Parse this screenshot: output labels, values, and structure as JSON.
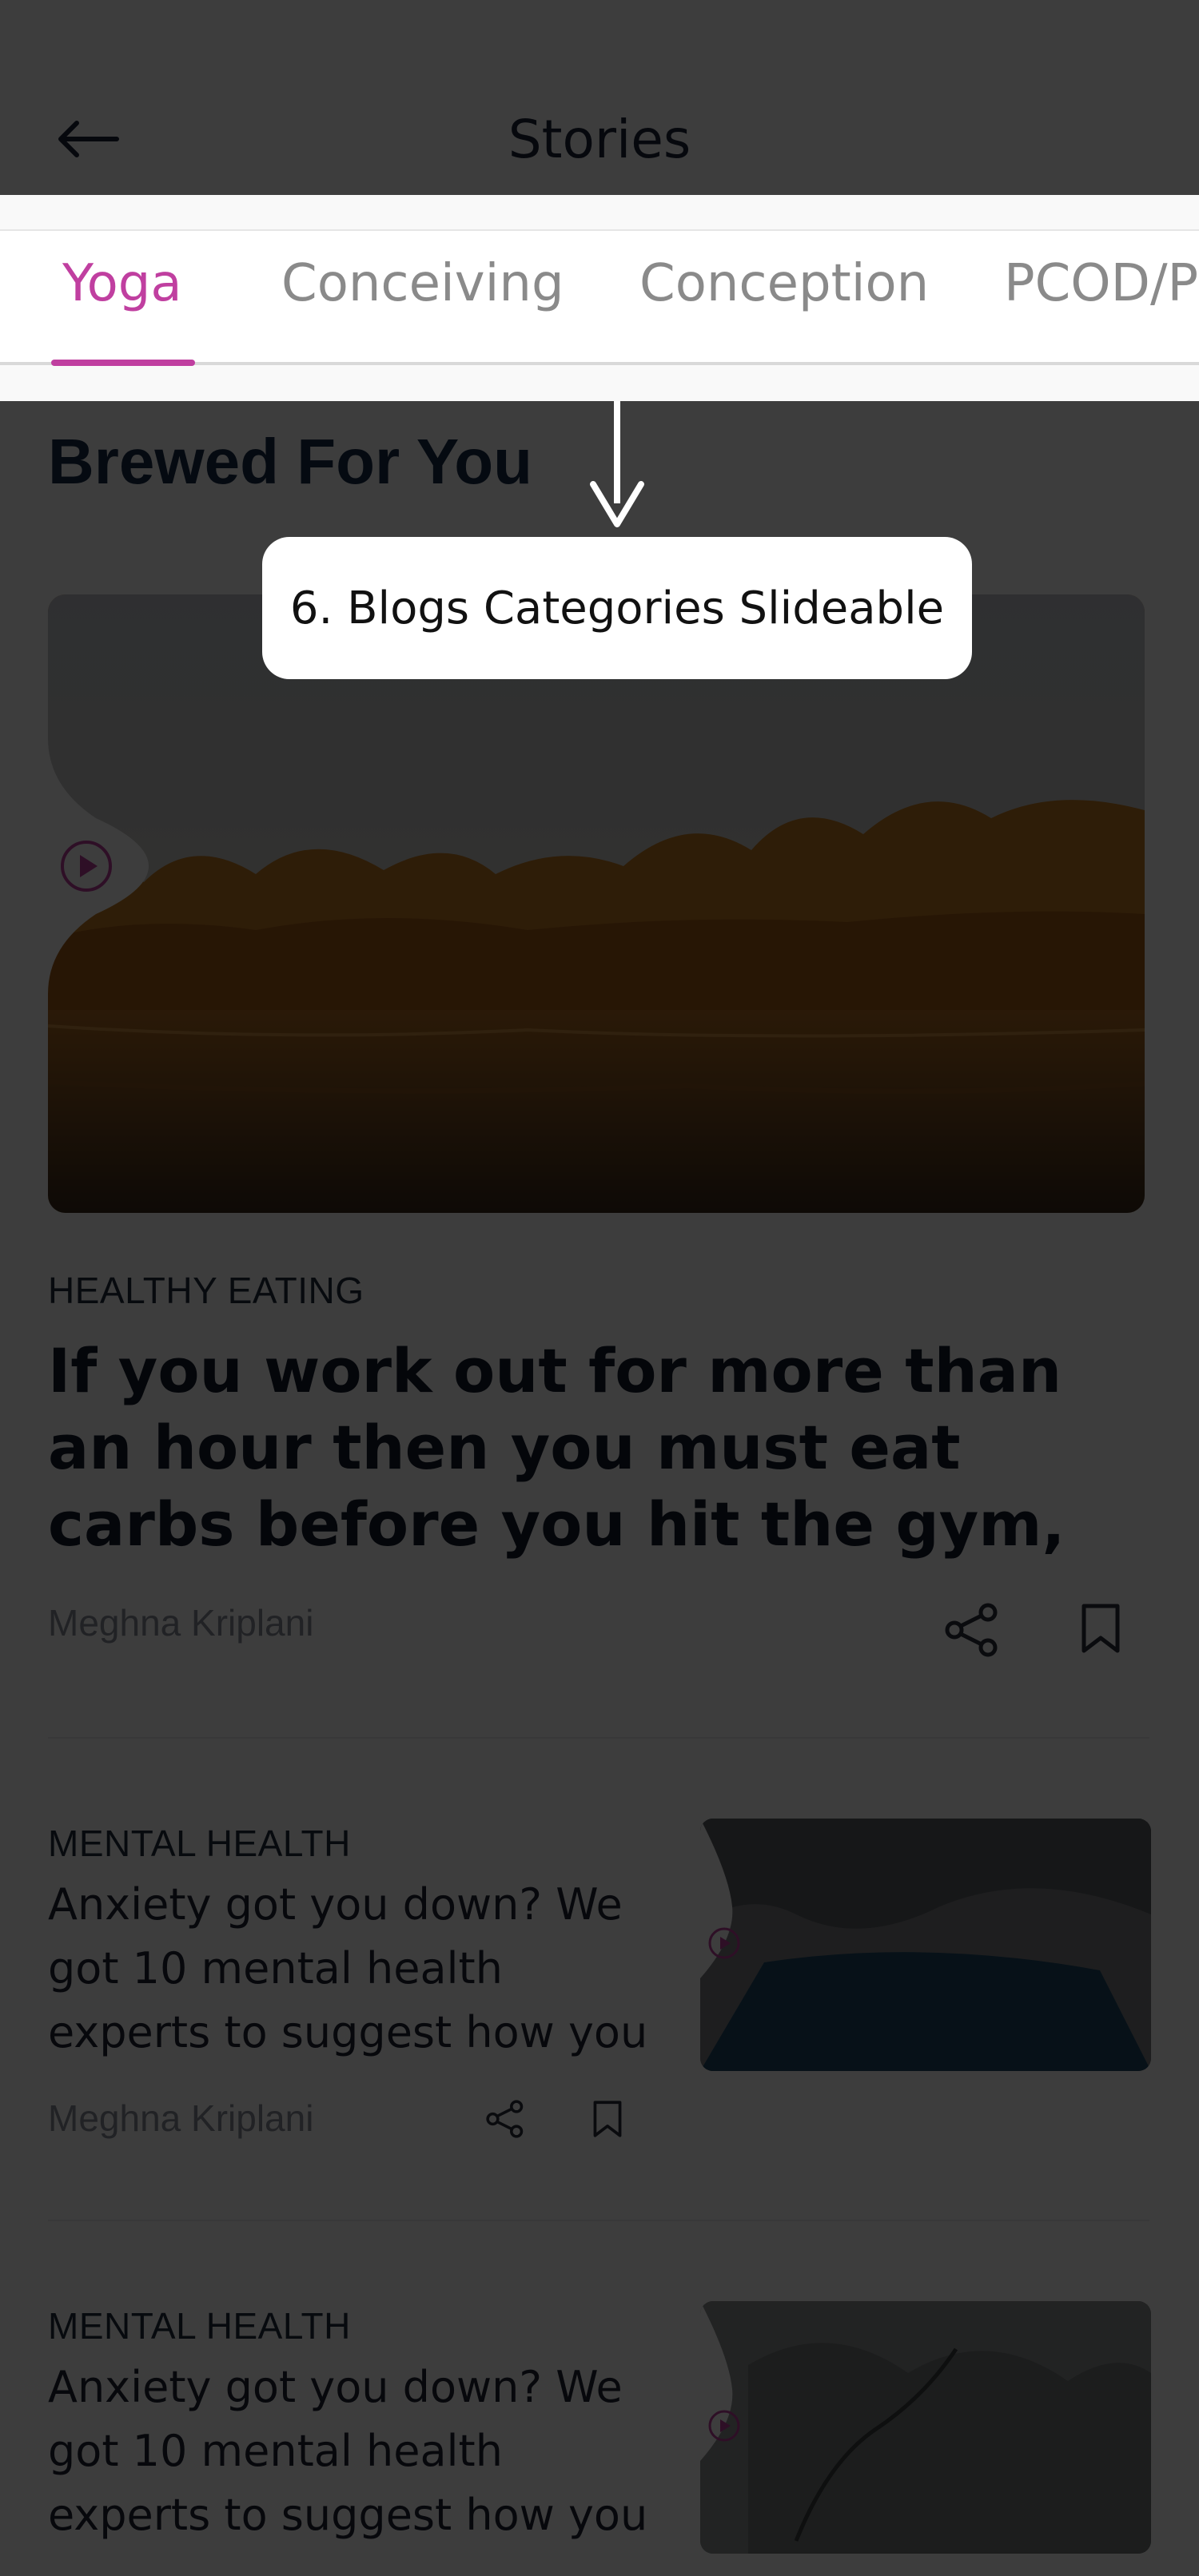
{
  "header": {
    "title": "Stories",
    "back_icon": "arrow-left-icon"
  },
  "tabs": [
    {
      "label": "Yoga",
      "active": true
    },
    {
      "label": "Conceiving",
      "active": false
    },
    {
      "label": "Conception",
      "active": false
    },
    {
      "label": "PCOD/P",
      "active": false
    }
  ],
  "section": {
    "title": "Brewed For You"
  },
  "featured": {
    "category": "HEALTHY EATING",
    "title": "If you work out for more than an hour then you must eat carbs before you hit the gym,",
    "author": "Meghna Kriplani",
    "share_icon": "share-icon",
    "bookmark_icon": "bookmark-icon"
  },
  "articles": [
    {
      "category": "MENTAL HEALTH",
      "title": "Anxiety got you down? We got 10 mental health experts to suggest how you",
      "author": "Meghna Kriplani"
    },
    {
      "category": "MENTAL HEALTH",
      "title": "Anxiety got you down? We got 10 mental health experts to suggest how you"
    }
  ],
  "tooltip": {
    "text": "6. Blogs Categories Slideable"
  },
  "colors": {
    "accent": "#c03fa0",
    "overlay": "rgba(0,0,0,0.76)",
    "title": "#172a48"
  }
}
